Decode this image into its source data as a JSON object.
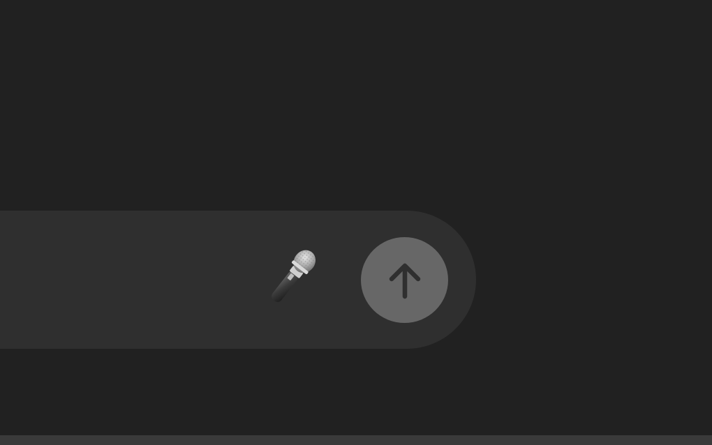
{
  "colors": {
    "background": "#212121",
    "composer_background": "#2f2f2f",
    "send_button_background": "#676767",
    "send_icon": "#2f2f2f",
    "bottom_strip": "#3a3a3a"
  },
  "composer": {
    "mic_icon": "microphone-icon",
    "send_icon": "arrow-up-icon",
    "send_state": "disabled"
  }
}
